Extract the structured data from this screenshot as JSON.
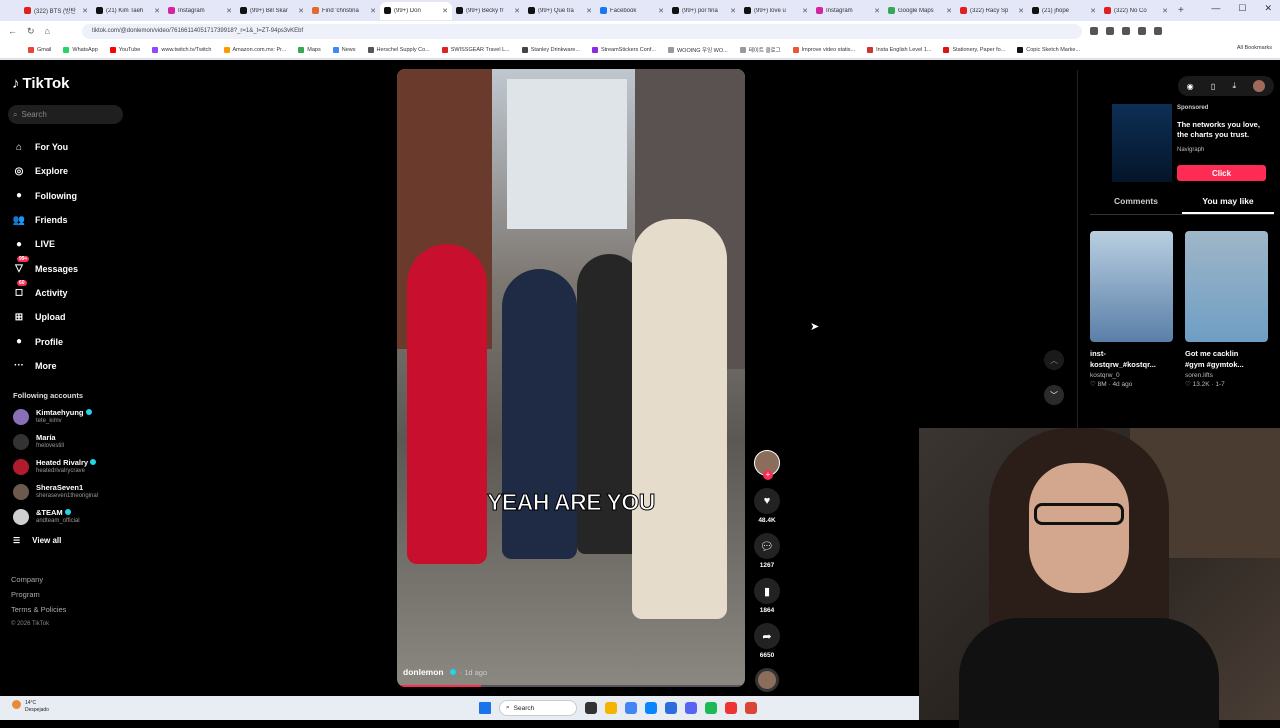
{
  "browser": {
    "tabs": [
      {
        "title": "(322) BTS (방탄",
        "color": "#e01f1f",
        "active": false
      },
      {
        "title": "(21) Kim Taeh",
        "color": "#111111",
        "active": false
      },
      {
        "title": "Instagram",
        "color": "#d6249f",
        "active": false
      },
      {
        "title": "(99+) Bill Skar",
        "color": "#111111",
        "active": false
      },
      {
        "title": "Find 'christina",
        "color": "#e36a2a",
        "active": false
      },
      {
        "title": "(99+) Don",
        "color": "#111111",
        "active": true
      },
      {
        "title": "(99+) Becky fr",
        "color": "#111111",
        "active": false
      },
      {
        "title": "(99+) Que tra",
        "color": "#111111",
        "active": false
      },
      {
        "title": "Facebook",
        "color": "#1877f2",
        "active": false
      },
      {
        "title": "(99+) por fina",
        "color": "#111111",
        "active": false
      },
      {
        "title": "(99+) love u",
        "color": "#111111",
        "active": false
      },
      {
        "title": "Instagram",
        "color": "#d6249f",
        "active": false
      },
      {
        "title": "Google Maps",
        "color": "#34a853",
        "active": false
      },
      {
        "title": "(322) Racy Sp",
        "color": "#e01f1f",
        "active": false
      },
      {
        "title": "(21) jhope",
        "color": "#111111",
        "active": false
      },
      {
        "title": "(322) No Co",
        "color": "#e01f1f",
        "active": false
      }
    ],
    "new_tab": "+",
    "url": "tiktok.com/@donlemon/video/7616611405171739918?_r=1&_t=ZT-94ps3vKEbf",
    "bookmarks": [
      {
        "label": "Gmail",
        "color": "#ea4335"
      },
      {
        "label": "WhatsApp",
        "color": "#25d366"
      },
      {
        "label": "YouTube",
        "color": "#ff0000"
      },
      {
        "label": "www.twitch.tv/Twitch",
        "color": "#9146ff"
      },
      {
        "label": "Amazon.com.mx: Pr...",
        "color": "#f90"
      },
      {
        "label": "Maps",
        "color": "#34a853"
      },
      {
        "label": "News",
        "color": "#4285f4"
      },
      {
        "label": "Herschel Supply Co...",
        "color": "#555"
      },
      {
        "label": "SWISSGEAR Travel L...",
        "color": "#d22"
      },
      {
        "label": "Stanley Drinkware...",
        "color": "#444"
      },
      {
        "label": "StreamStickers Conf...",
        "color": "#8a2be2"
      },
      {
        "label": "WOOING 우잉 WO...",
        "color": "#999"
      },
      {
        "label": "테이트 클로그",
        "color": "#999"
      },
      {
        "label": "Improve video statis...",
        "color": "#e53"
      },
      {
        "label": "Insta English Level 1...",
        "color": "#c33"
      },
      {
        "label": "Stationery, Paper fo...",
        "color": "#d11"
      },
      {
        "label": "Copic Sketch Marke...",
        "color": "#111"
      }
    ],
    "all_bookmarks": "All Bookmarks"
  },
  "sidebar": {
    "logo": "TikTok",
    "search_placeholder": "Search",
    "nav": [
      {
        "label": "For You",
        "icon": "home-icon",
        "glyph": "⌂"
      },
      {
        "label": "Explore",
        "icon": "compass-icon",
        "glyph": "◎"
      },
      {
        "label": "Following",
        "icon": "following-icon",
        "glyph": "●"
      },
      {
        "label": "Friends",
        "icon": "friends-icon",
        "glyph": "👥"
      },
      {
        "label": "LIVE",
        "icon": "live-icon",
        "glyph": "●"
      },
      {
        "label": "Messages",
        "icon": "messages-icon",
        "glyph": "▽",
        "badge": "99+"
      },
      {
        "label": "Activity",
        "icon": "activity-icon",
        "glyph": "◻",
        "badge": "60"
      },
      {
        "label": "Upload",
        "icon": "upload-icon",
        "glyph": "⊞"
      },
      {
        "label": "Profile",
        "icon": "profile-icon",
        "glyph": "●"
      },
      {
        "label": "More",
        "icon": "more-icon",
        "glyph": "···"
      }
    ],
    "following_header": "Following accounts",
    "accounts": [
      {
        "name": "Kimtaehyung",
        "handle": "tete_kimv",
        "verified": true,
        "color": "#8a6fb8"
      },
      {
        "name": "María",
        "handle": "fnelovestill",
        "verified": false,
        "color": "#333"
      },
      {
        "name": "Heated Rivalry",
        "handle": "heatedrivalrycrave",
        "verified": true,
        "color": "#b01b2e"
      },
      {
        "name": "SheraSeven1",
        "handle": "sheraseven1theoriginal",
        "verified": false,
        "color": "#6d5a4e"
      },
      {
        "name": "&TEAM",
        "handle": "andteam_official",
        "verified": true,
        "color": "#cfcfcf"
      }
    ],
    "view_all": "View all",
    "footer": [
      "Company",
      "Program",
      "Terms & Policies"
    ],
    "copyright": "© 2026 TikTok"
  },
  "video": {
    "caption": "YEAH ARE YOU",
    "author": "donlemon",
    "date": "· 1d ago",
    "progress": 0.24
  },
  "actions": {
    "likes": "48.4K",
    "comments": "1267",
    "saves": "1864",
    "shares": "6650"
  },
  "right_panel": {
    "ad": {
      "sponsored": "Sponsored",
      "text": "The networks you love, the charts you trust.",
      "brand": "Navigraph",
      "cta": "Click"
    },
    "tabs": [
      {
        "label": "Comments",
        "active": false
      },
      {
        "label": "You may like",
        "active": true
      }
    ],
    "suggestions": [
      {
        "caption": "inst-kostqrw_#kostqr...",
        "user": "kostqrw_0",
        "stats": "♡ 8M · 4d ago",
        "color": "#5a7fa8"
      },
      {
        "caption": "Got me cacklin #gym #gymtok...",
        "user": "soren.lifts",
        "stats": "♡ 13.2K · 1-7",
        "color": "#6e9ec4"
      }
    ]
  },
  "taskbar": {
    "temp": "14°C",
    "weather": "Despejado",
    "search": "Search"
  }
}
